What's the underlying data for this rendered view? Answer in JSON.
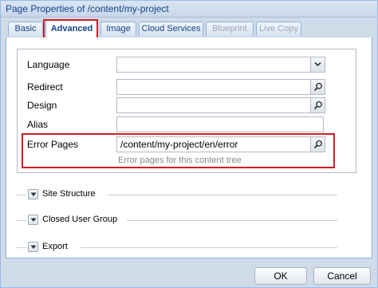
{
  "window": {
    "title": "Page Properties of /content/my-project"
  },
  "tabs": [
    {
      "label": "Basic"
    },
    {
      "label": "Advanced"
    },
    {
      "label": "Image"
    },
    {
      "label": "Cloud Services"
    },
    {
      "label": "Blueprint"
    },
    {
      "label": "Live Copy"
    }
  ],
  "form": {
    "language_label": "Language",
    "language_value": "",
    "redirect_label": "Redirect",
    "redirect_value": "",
    "design_label": "Design",
    "design_value": "",
    "alias_label": "Alias",
    "alias_value": "",
    "error_pages_label": "Error Pages",
    "error_pages_value": "/content/my-project/en/error",
    "error_pages_hint": "Error pages for this content tree"
  },
  "sections": [
    {
      "label": "Site Structure"
    },
    {
      "label": "Closed User Group"
    },
    {
      "label": "Export"
    }
  ],
  "buttons": {
    "ok": "OK",
    "cancel": "Cancel"
  },
  "colors": {
    "highlight": "#d31b26",
    "tab_text": "#15428b"
  }
}
